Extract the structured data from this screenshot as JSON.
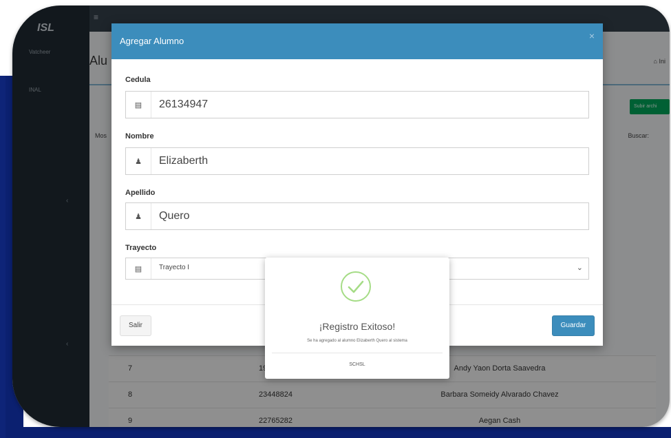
{
  "app": {
    "logo": "ISL",
    "user_name": "Vatcheer",
    "nav_item": "INAL",
    "page_title_fragment": "Alu",
    "breadcrumb_home": "Ini",
    "add_button_label": "Subir archi",
    "show_entries_fragment": "Mos",
    "search_label": "Buscar:"
  },
  "modal": {
    "title": "Agregar Alumno",
    "close_label": "×",
    "fields": {
      "cedula": {
        "label": "Cedula",
        "value": "26134947",
        "icon": "id-card-icon"
      },
      "nombre": {
        "label": "Nombre",
        "value": "Elizaberth",
        "icon": "user-icon"
      },
      "apellido": {
        "label": "Apellido",
        "value": "Quero",
        "icon": "user-icon"
      },
      "trayecto": {
        "label": "Trayecto",
        "value": "Trayecto I",
        "icon": "id-card-icon"
      }
    },
    "buttons": {
      "exit": "Salir",
      "save": "Guardar"
    }
  },
  "alert": {
    "title": "¡Registro Exitoso!",
    "text": "Se ha agregado al alumno Elizaberth Quero al sistema",
    "footer": "SCHSL",
    "icon": "success-check-icon",
    "icon_color": "#a5dc86"
  },
  "table": {
    "rows": [
      {
        "num": "7",
        "cedula": "19",
        "name": "Andy Yaon Dorta Saavedra"
      },
      {
        "num": "8",
        "cedula": "23448824",
        "name": "Barbara Someidy Alvarado Chavez"
      },
      {
        "num": "9",
        "cedula": "22765282",
        "name": "Aegan Cash"
      }
    ]
  },
  "colors": {
    "header_blue": "#3c8dbc",
    "frame_navy": "#0b2070",
    "add_green": "#00a65a"
  }
}
